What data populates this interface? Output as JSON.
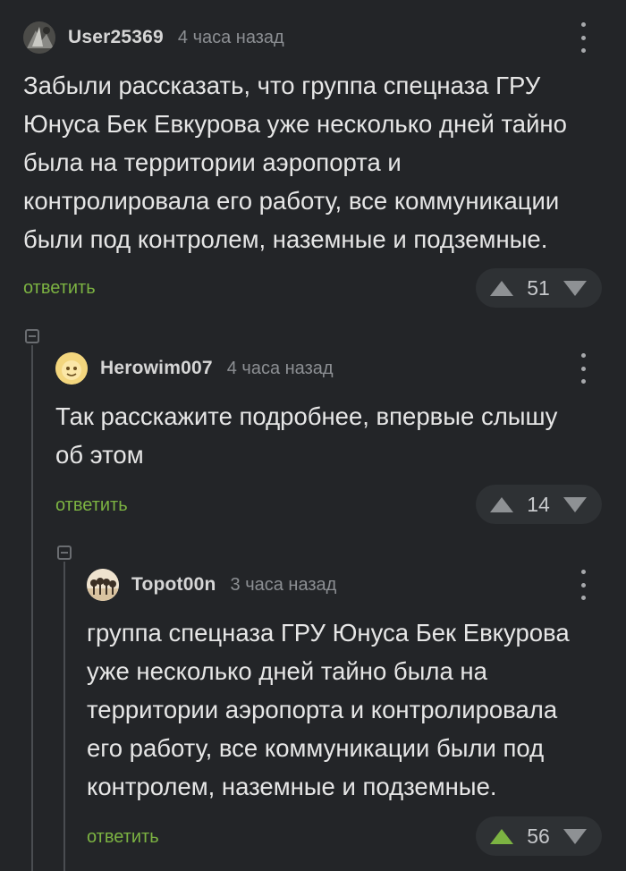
{
  "comments": [
    {
      "username": "User25369",
      "time": "4 часа назад",
      "text": "Забыли рассказать, что группа спецназа ГРУ\nЮнуса Бек Евкурова уже несколько дней тайно\nбыла на территории аэропорта и\nконтролировала его работу, все коммуникации\nбыли под контролем, наземные и подземные.",
      "reply_label": "ответить",
      "score": "51",
      "upvoted": false
    },
    {
      "username": "Herowim007",
      "time": "4 часа назад",
      "text": "Так расскажите подробнее, впервые слышу\nоб этом",
      "reply_label": "ответить",
      "score": "14",
      "upvoted": false
    },
    {
      "username": "Topot00n",
      "time": "3 часа назад",
      "text": "группа спецназа ГРУ Юнуса Бек Евкурова\nуже несколько дней тайно была на\nтерритории аэропорта и контролировала\nего работу, все коммуникации были под\nконтролем, наземные и подземные.",
      "reply_label": "ответить",
      "score": "56",
      "upvoted": true
    }
  ],
  "colors": {
    "background": "#232528",
    "accent_green": "#7cb342",
    "vote_pill": "#2e3134"
  },
  "icons": [
    "avatar",
    "kebab-menu-icon",
    "upvote-arrow-icon",
    "downvote-arrow-icon",
    "collapse-thread-icon"
  ]
}
